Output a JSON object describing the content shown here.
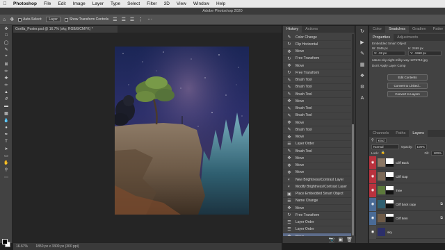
{
  "menubar": {
    "app_name": "Photoshop",
    "items": [
      "File",
      "Edit",
      "Image",
      "Layer",
      "Type",
      "Select",
      "Filter",
      "3D",
      "View",
      "Window",
      "Help"
    ]
  },
  "window": {
    "title": "Adobe Photoshop 2020"
  },
  "options_bar": {
    "auto_select_label": "Auto-Select:",
    "auto_select_value": "Layer",
    "transform_controls_label": "Show Transform Controls"
  },
  "document": {
    "tab_title": "Gorilla_Poster.psd @ 16.7% (sky, RGB/8/CMYK) *"
  },
  "status_bar": {
    "zoom": "16.67%",
    "doc_info": "1850 px x 3300 px (300 ppi)"
  },
  "history": {
    "tabs": [
      "History",
      "Actions"
    ],
    "states": [
      "Color Change",
      "Flip Horizontal",
      "Move",
      "Free Transform",
      "Move",
      "Free Transform",
      "Brush Tool",
      "Brush Tool",
      "Brush Tool",
      "Move",
      "Brush Tool",
      "Brush Tool",
      "Move",
      "Brush Tool",
      "Move",
      "Layer Order",
      "Brush Tool",
      "Move",
      "Move",
      "Move",
      "New Brightness/Contrast Layer",
      "Modify Brightness/Contrast Layer",
      "Place Embedded Smart Object",
      "Name Change",
      "Move",
      "Free Transform",
      "Layer Order",
      "Layer Order",
      "Move"
    ],
    "state_icons": [
      "brush-icon",
      "transform-icon",
      "move-icon",
      "transform-icon",
      "move-icon",
      "transform-icon",
      "brush-icon",
      "brush-icon",
      "brush-icon",
      "move-icon",
      "brush-icon",
      "brush-icon",
      "move-icon",
      "brush-icon",
      "move-icon",
      "layers-icon",
      "brush-icon",
      "move-icon",
      "move-icon",
      "move-icon",
      "adjustment-icon",
      "adjustment-icon",
      "place-icon",
      "layers-icon",
      "move-icon",
      "transform-icon",
      "layers-icon",
      "layers-icon",
      "move-icon"
    ],
    "selected_index": 28
  },
  "right_tabs": [
    "Color",
    "Swatches",
    "Gradien",
    "Patter"
  ],
  "properties": {
    "tabs": [
      "Properties",
      "Adjustments"
    ],
    "object_type": "Embedded Smart Object",
    "w_label": "W:",
    "w_value": "2846 px",
    "h_label": "H:",
    "h_value": "2469 px",
    "x_label": "X:",
    "x_value": "-32 px",
    "y_label": "Y:",
    "y_value": "-1968 px",
    "filename": "nature-sky-night-milky-way-1275713.jpg",
    "layer_comp": "Don't Apply Layer Comp",
    "buttons": [
      "Edit Contents",
      "Convert to Linked...",
      "Convert to Layers"
    ]
  },
  "layers_panel": {
    "tabs": [
      "Channels",
      "Paths",
      "Layers"
    ],
    "filter_kind": "Kind",
    "blend_mode": "Normal",
    "opacity_label": "Opacity:",
    "opacity_value": "100%",
    "lock_label": "Lock:",
    "fill_label": "Fill:",
    "fill_value": "100%",
    "layers": [
      {
        "name": "Cliff Back",
        "eye_color": "#b9323e"
      },
      {
        "name": "Cliff Gap",
        "eye_color": "#b9323e"
      },
      {
        "name": "Tree",
        "eye_color": "#b9323e"
      },
      {
        "name": "Cliff back copy",
        "eye_color": "#4a6b96"
      },
      {
        "name": "Cliff Item",
        "eye_color": "#4a6b96"
      },
      {
        "name": "sky",
        "eye_color": "#4a4a4a"
      }
    ]
  },
  "colors": {
    "selection": "#5d6c8a",
    "red_layer_tag": "#b9323e",
    "blue_layer_tag": "#4a6b96"
  }
}
